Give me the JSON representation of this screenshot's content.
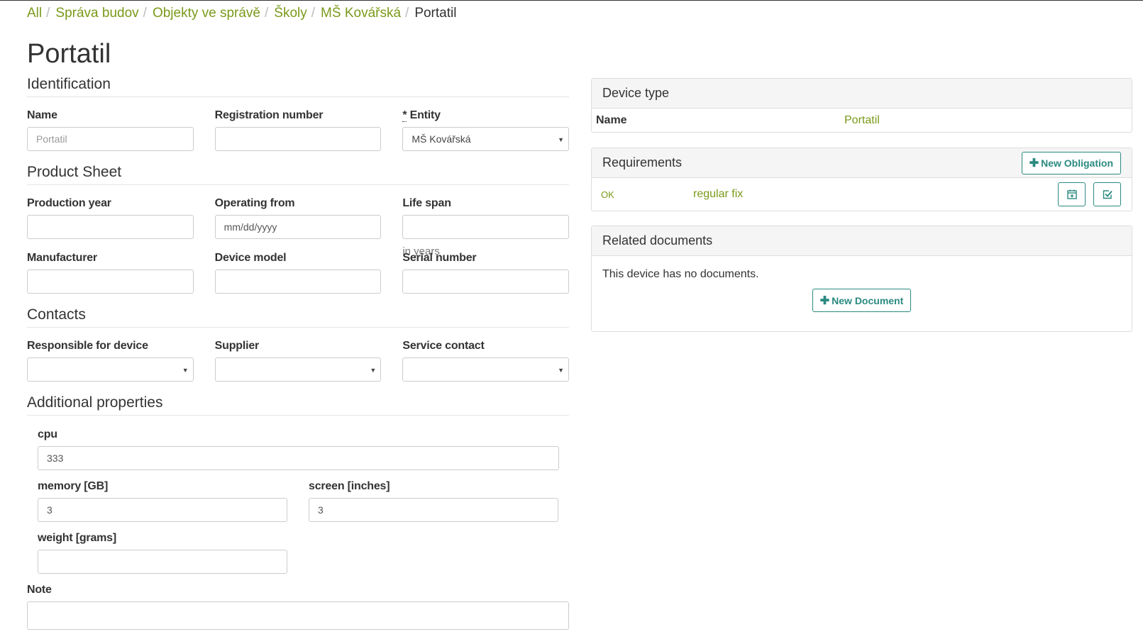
{
  "breadcrumb": [
    "All",
    "Správa budov",
    "Objekty ve správě",
    "Školy",
    "MŠ Kovářská"
  ],
  "breadcrumb_current": "Portatil",
  "page_title": "Portatil",
  "identification": {
    "title": "Identification",
    "name_label": "Name",
    "name_placeholder": "Portatil",
    "registration_label": "Registration number",
    "registration_value": "",
    "entity_star": "*",
    "entity_label": " Entity",
    "entity_value": "MŠ Kovářská"
  },
  "product_sheet": {
    "title": "Product Sheet",
    "production_year_label": "Production year",
    "operating_from_label": "Operating from",
    "operating_from_placeholder": "mm/dd/yyyy",
    "life_span_label": "Life span",
    "life_span_help": "in years",
    "manufacturer_label": "Manufacturer",
    "device_model_label": "Device model",
    "serial_number_label": "Serial number"
  },
  "contacts": {
    "title": "Contacts",
    "responsible_label": "Responsible for device",
    "supplier_label": "Supplier",
    "service_contact_label": "Service contact"
  },
  "additional": {
    "title": "Additional properties",
    "cpu_label": "cpu",
    "cpu_value": "333",
    "memory_label": "memory [GB]",
    "memory_value": "3",
    "screen_label": "screen [inches]",
    "screen_value": "3",
    "weight_label": "weight [grams]",
    "weight_value": ""
  },
  "note_label": "Note",
  "device_type": {
    "title": "Device type",
    "name_label": "Name",
    "name_value": "Portatil"
  },
  "requirements": {
    "title": "Requirements",
    "new_obligation_label": "New Obligation",
    "status": "OK",
    "item": "regular fix"
  },
  "related_documents": {
    "title": "Related documents",
    "empty_text": "This device has no documents.",
    "new_document_label": "New Document"
  },
  "colors": {
    "link": "#7a9a1a",
    "accent": "#2a8a80"
  }
}
